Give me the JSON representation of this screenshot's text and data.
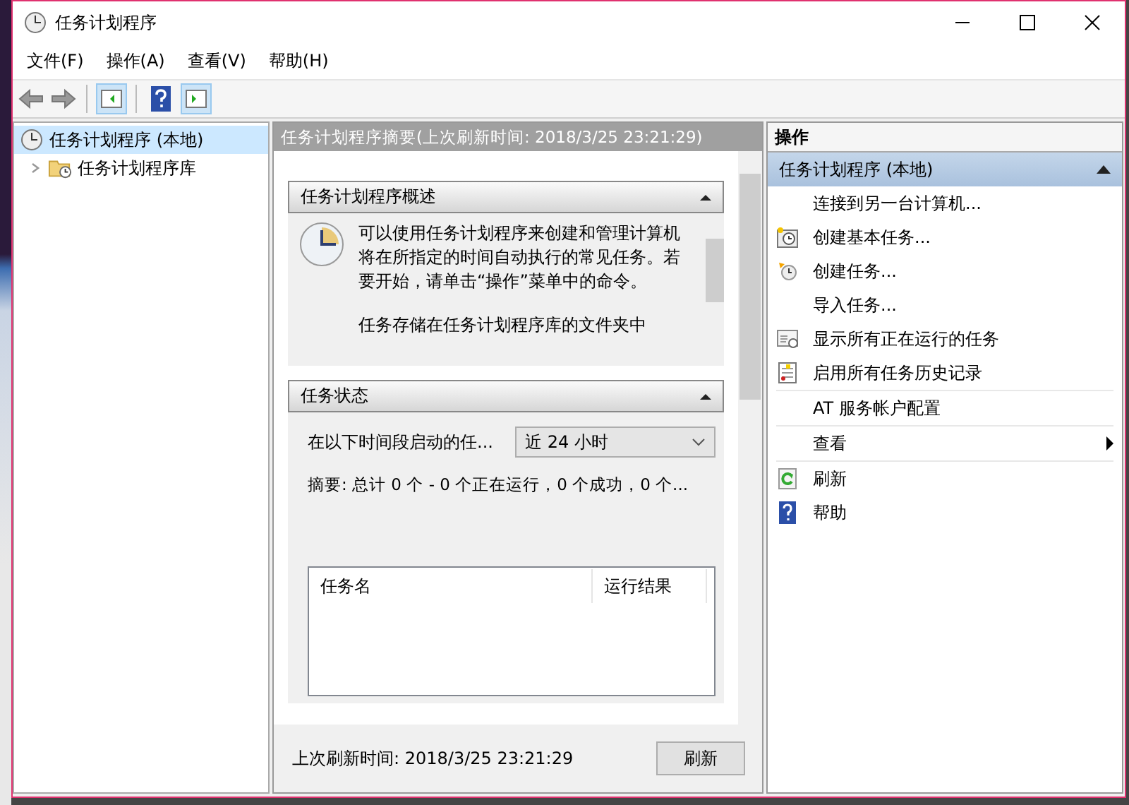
{
  "window": {
    "title": "任务计划程序"
  },
  "menu": [
    {
      "label": "文件(F)"
    },
    {
      "label": "操作(A)"
    },
    {
      "label": "查看(V)"
    },
    {
      "label": "帮助(H)"
    }
  ],
  "tree": [
    {
      "label": "任务计划程序 (本地)",
      "selected": true,
      "children": [
        {
          "label": "任务计划程序库",
          "selected": false,
          "expanded": false
        }
      ]
    }
  ],
  "summary": {
    "header": "任务计划程序摘要(上次刷新时间: 2018/3/25 23:21:29)",
    "overview": {
      "title": "任务计划程序概述",
      "expanded": true,
      "paragraphs": [
        "可以使用任务计划程序来创建和管理计算机将在所指定的时间自动执行的常见任务。若要开始，请单击“操作”菜单中的命令。",
        "任务存储在任务计划程序库的文件夹中"
      ]
    },
    "status": {
      "title": "任务状态",
      "expanded": true,
      "filter_label": "在以下时间段启动的任...",
      "filter_value": "近 24 小时",
      "summary": "摘要: 总计 0 个 - 0 个正在运行，0 个成功，0 个...",
      "columns": [
        "任务名",
        "运行结果"
      ]
    },
    "footer": {
      "text": "上次刷新时间: 2018/3/25 23:21:29",
      "button": "刷新"
    }
  },
  "actions": {
    "title": "操作",
    "group": {
      "label": "任务计划程序 (本地)",
      "expanded": true
    },
    "items": [
      {
        "label": "连接到另一台计算机...",
        "kind": "plain",
        "separator": false
      },
      {
        "label": "创建基本任务...",
        "kind": "create-basic",
        "separator": false
      },
      {
        "label": "创建任务...",
        "kind": "create",
        "separator": false
      },
      {
        "label": "导入任务...",
        "kind": "plain",
        "separator": false
      },
      {
        "label": "显示所有正在运行的任务",
        "kind": "running",
        "separator": false
      },
      {
        "label": "启用所有任务历史记录",
        "kind": "history",
        "separator": false
      },
      {
        "label": "AT 服务帐户配置",
        "kind": "plain",
        "separator": true
      },
      {
        "label": "查看",
        "kind": "submenu",
        "separator": true
      },
      {
        "label": "刷新",
        "kind": "refresh",
        "separator": true
      },
      {
        "label": "帮助",
        "kind": "help",
        "separator": false
      }
    ]
  }
}
